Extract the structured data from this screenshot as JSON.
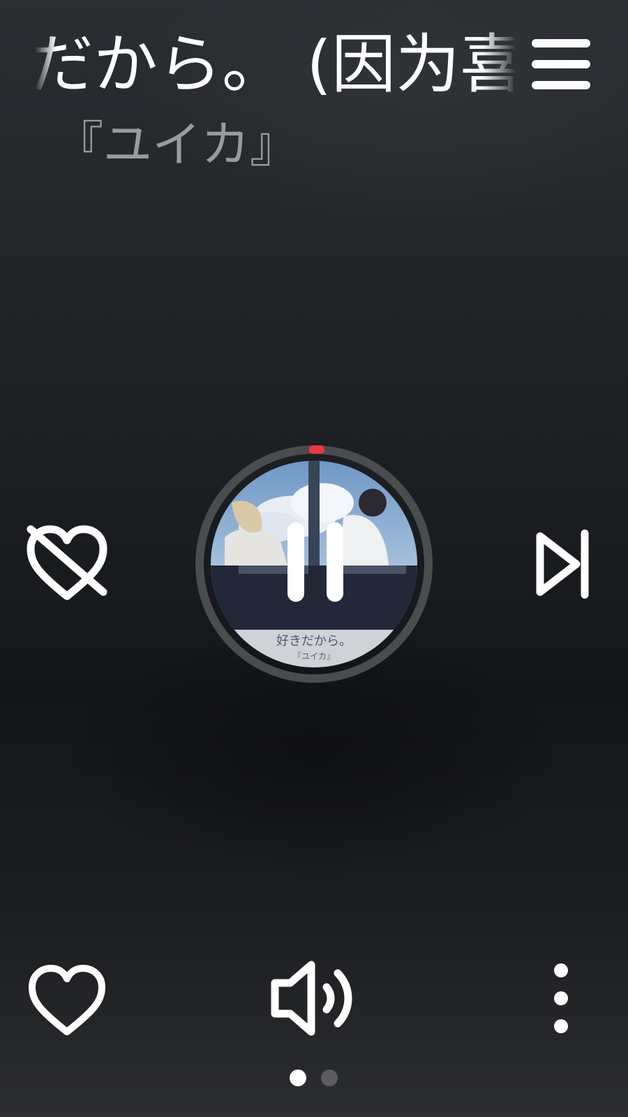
{
  "now_playing": {
    "title": "だから。 (因为喜欢",
    "artist": "『ユイカ』"
  },
  "progress_fraction": 0.0,
  "icons": {
    "menu": "hamburger-menu-icon",
    "dislike": "heart-crossed-icon",
    "next": "skip-next-icon",
    "pause": "pause-icon",
    "favorite": "heart-outline-icon",
    "volume": "speaker-volume-icon",
    "more": "more-vertical-icon"
  },
  "album_art": {
    "caption_line1": "好きだから。",
    "caption_line2": "『ユイカ』"
  },
  "pager": {
    "pages": 2,
    "active_index": 0
  },
  "colors": {
    "accent_progress": "#e8383f",
    "foreground": "#ffffff",
    "artist_text": "#9a9b9d",
    "ring": "#4b4c4f",
    "page_dot_active": "#ffffff",
    "page_dot_inactive": "#5c5d60"
  }
}
